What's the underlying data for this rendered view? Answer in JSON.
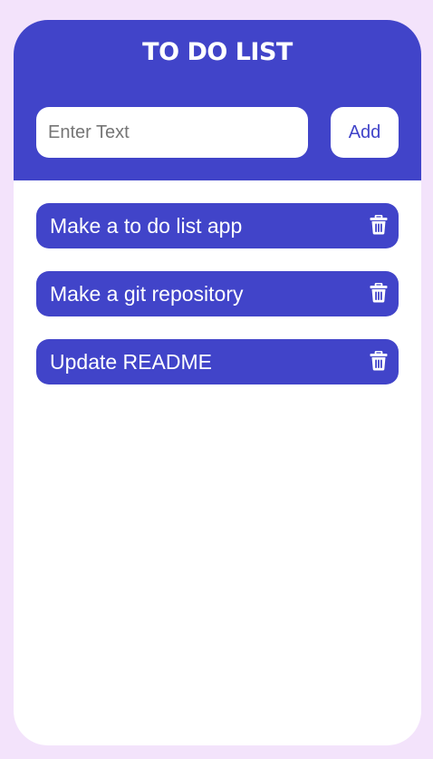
{
  "header": {
    "title": "TO DO LIST"
  },
  "input": {
    "placeholder": "Enter Text",
    "value": ""
  },
  "add_button": {
    "label": "Add"
  },
  "tasks": [
    {
      "text": "Make a to do list app",
      "action_icon": "trash-icon"
    },
    {
      "text": "Make a git repository",
      "action_icon": "trash-icon"
    },
    {
      "text": "Update README",
      "action_icon": "trash-icon"
    }
  ],
  "colors": {
    "page_background": "#f3e3fb",
    "accent": "#4144c9",
    "card_background": "#ffffff",
    "task_text": "#ffffff"
  }
}
